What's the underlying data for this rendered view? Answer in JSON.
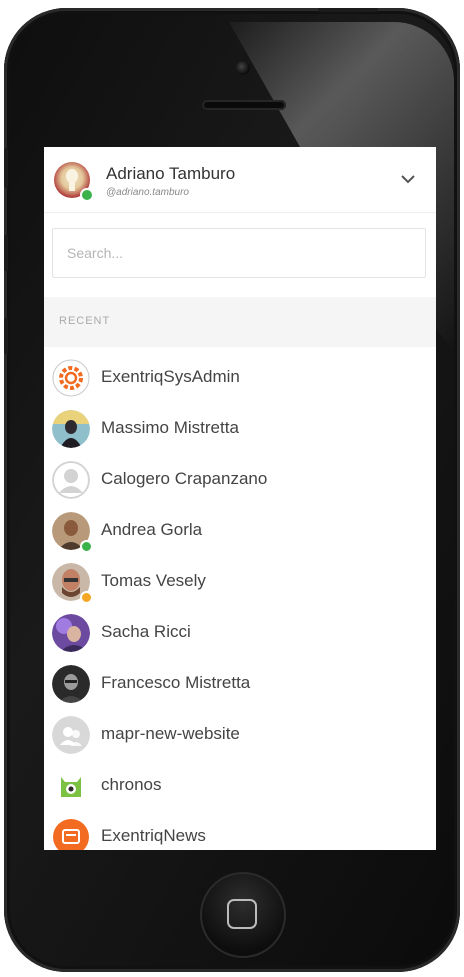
{
  "header": {
    "user_name": "Adriano Tamburo",
    "user_handle": "@adriano.tamburo",
    "status": "online"
  },
  "search": {
    "placeholder": "Search..."
  },
  "section": {
    "label": "RECENT"
  },
  "contacts": [
    {
      "name": "ExentriqSysAdmin",
      "icon": "gear-logo-icon",
      "status": ""
    },
    {
      "name": "Massimo Mistretta",
      "icon": "avatar-photo",
      "status": ""
    },
    {
      "name": "Calogero Crapanzano",
      "icon": "default-user-icon",
      "status": ""
    },
    {
      "name": "Andrea Gorla",
      "icon": "avatar-photo",
      "status": "online"
    },
    {
      "name": "Tomas Vesely",
      "icon": "avatar-photo",
      "status": "away"
    },
    {
      "name": "Sacha Ricci",
      "icon": "avatar-photo",
      "status": ""
    },
    {
      "name": "Francesco Mistretta",
      "icon": "avatar-photo",
      "status": ""
    },
    {
      "name": "mapr-new-website",
      "icon": "group-icon",
      "status": ""
    },
    {
      "name": "chronos",
      "icon": "monster-icon",
      "status": ""
    },
    {
      "name": "ExentriqNews",
      "icon": "news-logo-icon",
      "status": ""
    }
  ],
  "colors": {
    "online": "#3cb24a",
    "away": "#f5a623",
    "accent": "#f26b21"
  }
}
